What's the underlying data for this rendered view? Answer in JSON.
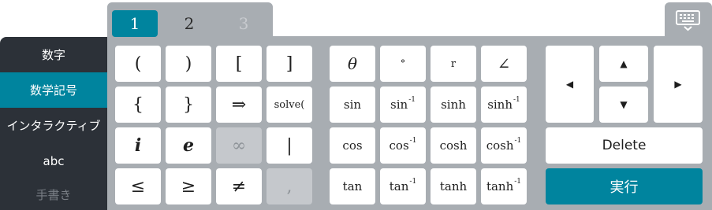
{
  "sidebar": {
    "items": [
      {
        "label": "数字"
      },
      {
        "label": "数学記号"
      },
      {
        "label": "インタラクティブ"
      },
      {
        "label": "abc"
      },
      {
        "label": "手書き"
      }
    ]
  },
  "tabs": [
    {
      "label": "1"
    },
    {
      "label": "2"
    },
    {
      "label": "3"
    }
  ],
  "keyboard_icon": "keyboard-icon",
  "keys": {
    "group1": [
      [
        "(",
        ")",
        "[",
        "]"
      ],
      [
        "{",
        "}",
        "⇒",
        "solve("
      ],
      [
        "i",
        "e",
        "∞",
        "|"
      ],
      [
        "≤",
        "≥",
        "≠",
        ","
      ]
    ],
    "group2": [
      [
        {
          "t": "θ"
        },
        {
          "t": "°"
        },
        {
          "t": "r"
        },
        {
          "t": "∠"
        }
      ],
      [
        {
          "t": "sin"
        },
        {
          "t": "sin",
          "s": "-1"
        },
        {
          "t": "sinh"
        },
        {
          "t": "sinh",
          "s": "-1"
        }
      ],
      [
        {
          "t": "cos"
        },
        {
          "t": "cos",
          "s": "-1"
        },
        {
          "t": "cosh"
        },
        {
          "t": "cosh",
          "s": "-1"
        }
      ],
      [
        {
          "t": "tan"
        },
        {
          "t": "tan",
          "s": "-1"
        },
        {
          "t": "tanh"
        },
        {
          "t": "tanh",
          "s": "-1"
        }
      ]
    ],
    "arrows": {
      "left": "◀",
      "up": "▲",
      "down": "▼",
      "right": "▶"
    },
    "delete": "Delete",
    "execute": "実行"
  },
  "colors": {
    "accent": "#00849e",
    "sidebar": "#2c3138",
    "panel": "#a8adb2",
    "key": "#ffffff",
    "key_disabled": "#c5c8cc"
  }
}
